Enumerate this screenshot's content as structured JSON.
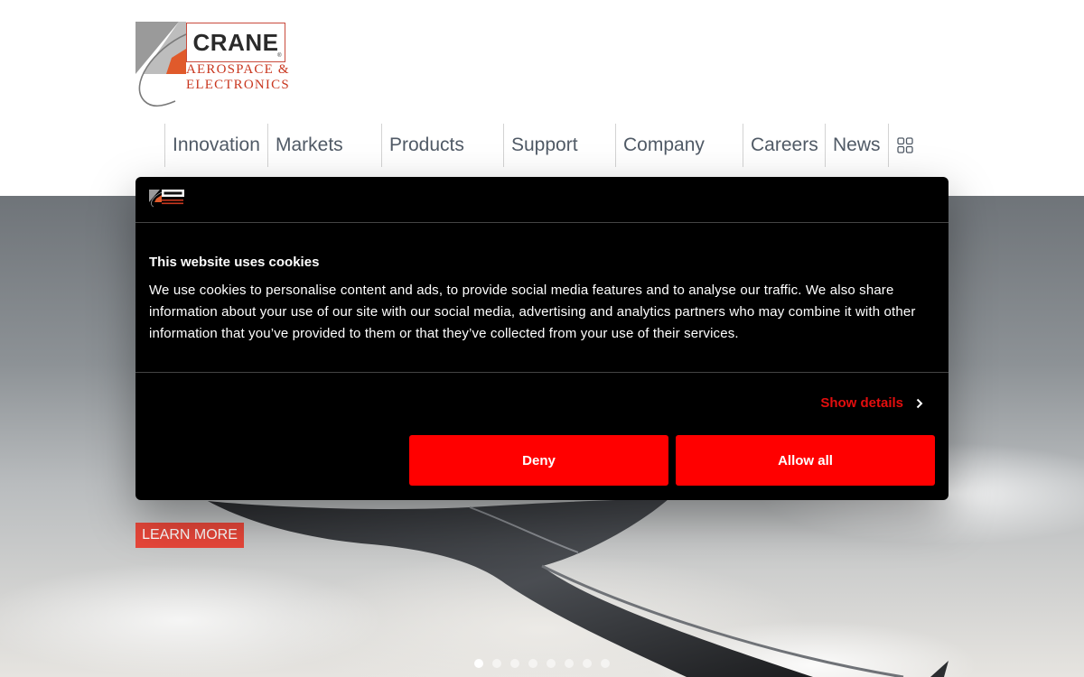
{
  "logo": {
    "brand": "CRANE",
    "reg": "®",
    "line1": "AEROSPACE &",
    "line2": "ELECTRONICS"
  },
  "nav": {
    "items": [
      "Innovation",
      "Markets",
      "Products",
      "Support",
      "Company",
      "Careers",
      "News"
    ]
  },
  "hero": {
    "cta_label": "LEARN MORE",
    "slide_count": 8,
    "active_slide": 1
  },
  "cookie_banner": {
    "title": "This website uses cookies",
    "body": "We use cookies to personalise content and ads, to provide social media features and to analyse our traffic. We also share information about your use of our site with our social media, advertising and analytics partners who may combine it with other information that you’ve provided to them or that they’ve collected from your use of their services.",
    "show_details": "Show details",
    "deny_label": "Deny",
    "allow_label": "Allow all"
  },
  "colors": {
    "accent": "#ff0000",
    "cta": "#e8473a",
    "brand_red": "#c9371f",
    "nav_text": "#505a66",
    "dialog_bg": "#000000"
  },
  "icons": {
    "grid": "grid-icon",
    "chevron": "chevron-right-icon"
  }
}
